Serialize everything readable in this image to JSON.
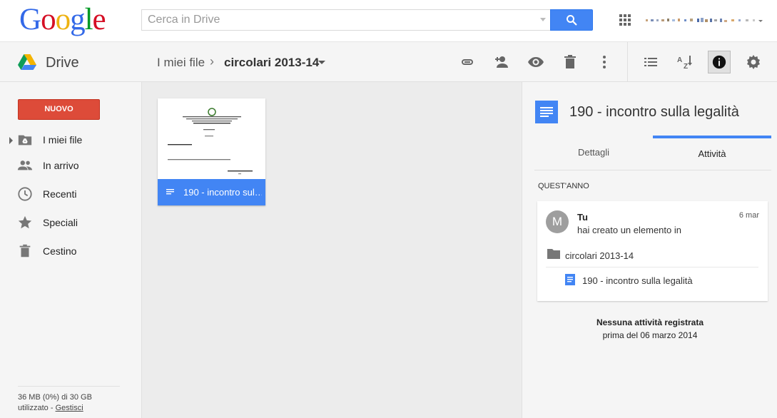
{
  "header": {
    "logo_text": "Google",
    "search": {
      "placeholder": "Cerca in Drive",
      "value": ""
    },
    "search_button_icon": "search-icon",
    "apps_icon": "apps-grid-icon"
  },
  "toolbar": {
    "app_name": "Drive",
    "breadcrumb": {
      "root": "I miei file",
      "separator": "›",
      "current": "circolari 2013-14"
    },
    "actions": [
      "link-icon",
      "share-icon",
      "preview-icon",
      "delete-icon",
      "more-icon"
    ],
    "view_actions": [
      "list-view-icon",
      "sort-icon",
      "details-icon",
      "settings-icon"
    ]
  },
  "sidebar": {
    "new_button": "NUOVO",
    "items": [
      {
        "label": "I miei file",
        "icon": "my-drive-folder-icon"
      },
      {
        "label": "In arrivo",
        "icon": "people-icon"
      },
      {
        "label": "Recenti",
        "icon": "clock-icon"
      },
      {
        "label": "Speciali",
        "icon": "star-icon"
      },
      {
        "label": "Cestino",
        "icon": "trash-icon"
      }
    ],
    "storage": {
      "line1": "36 MB (0%) di 30 GB",
      "line2_prefix": "utilizzato - ",
      "manage_link": "Gestisci"
    }
  },
  "main": {
    "files": [
      {
        "name": "190 - incontro sul…",
        "icon": "document-icon"
      }
    ]
  },
  "details": {
    "title": "190 - incontro sulla legalità",
    "tabs": [
      "Dettagli",
      "Attività"
    ],
    "active_tab": "Attività",
    "section_label": "QUEST'ANNO",
    "activity": {
      "avatar_letter": "M",
      "actor": "Tu",
      "date": "6 mar",
      "verb": "hai creato un elemento in",
      "folder": "circolari 2013-14",
      "file": "190 - incontro sulla legalità"
    },
    "no_activity_line1": "Nessuna attività registrata",
    "no_activity_line2": "prima del 06 marzo 2014"
  },
  "colors": {
    "accent_blue": "#4285f4",
    "new_red": "#dd4b39",
    "logo_blue": "#3369e8",
    "logo_red": "#d50f25",
    "logo_yellow": "#eeb211",
    "logo_green": "#009925"
  }
}
